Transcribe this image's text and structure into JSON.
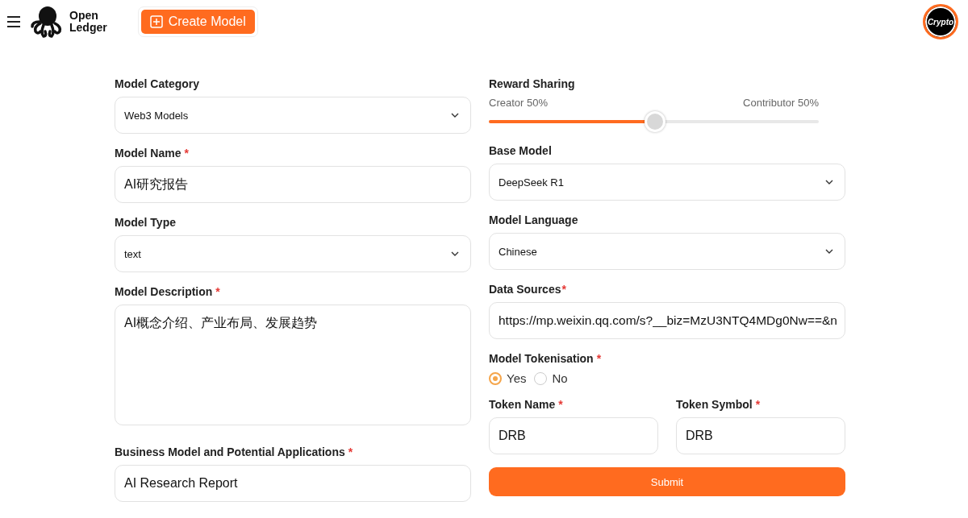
{
  "header": {
    "logo_text": [
      "Open",
      "Ledger"
    ],
    "create_button": "Create Model",
    "avatar_text": "Crypto"
  },
  "left_fields": [
    {
      "kind": "select",
      "label": "Model Category",
      "value": "Web3 Models"
    },
    {
      "kind": "input",
      "label": "Model Name",
      "required_mark": "*",
      "value": "AI研究报告"
    },
    {
      "kind": "select",
      "label": "Model Type",
      "value": "text"
    },
    {
      "kind": "textarea",
      "label": "Model Description",
      "required_mark": "*",
      "value": "AI概念介绍、产业布局、发展趋势"
    },
    {
      "kind": "input",
      "label": "Business Model and Potential Applications",
      "required_mark": "*",
      "value": "AI Research Report"
    }
  ],
  "reward_sharing": {
    "label": "Reward Sharing",
    "left_text": "Creator 50%",
    "right_text": "Contributor 50%",
    "level": 0.5
  },
  "right_fields": [
    {
      "kind": "select",
      "label": "Base Model",
      "value": "DeepSeek R1"
    },
    {
      "kind": "select",
      "label": "Model Language",
      "value": "Chinese"
    },
    {
      "kind": "input",
      "label": "Data Sources",
      "required_mark": "*",
      "value": "https://mp.weixin.qq.com/s?__biz=MzU3NTQ4MDg0Nw==&n"
    }
  ],
  "tokenisation": {
    "label": "Model Tokenisation",
    "required_mark": "*",
    "options": [
      {
        "label": "Yes",
        "selected": true
      },
      {
        "label": "No",
        "selected": false
      }
    ]
  },
  "token_fields": [
    {
      "label": "Token Name",
      "required_mark": "*",
      "value": "DRB"
    },
    {
      "label": "Token Symbol",
      "required_mark": "*",
      "value": "DRB"
    }
  ],
  "submit": "Submit"
}
